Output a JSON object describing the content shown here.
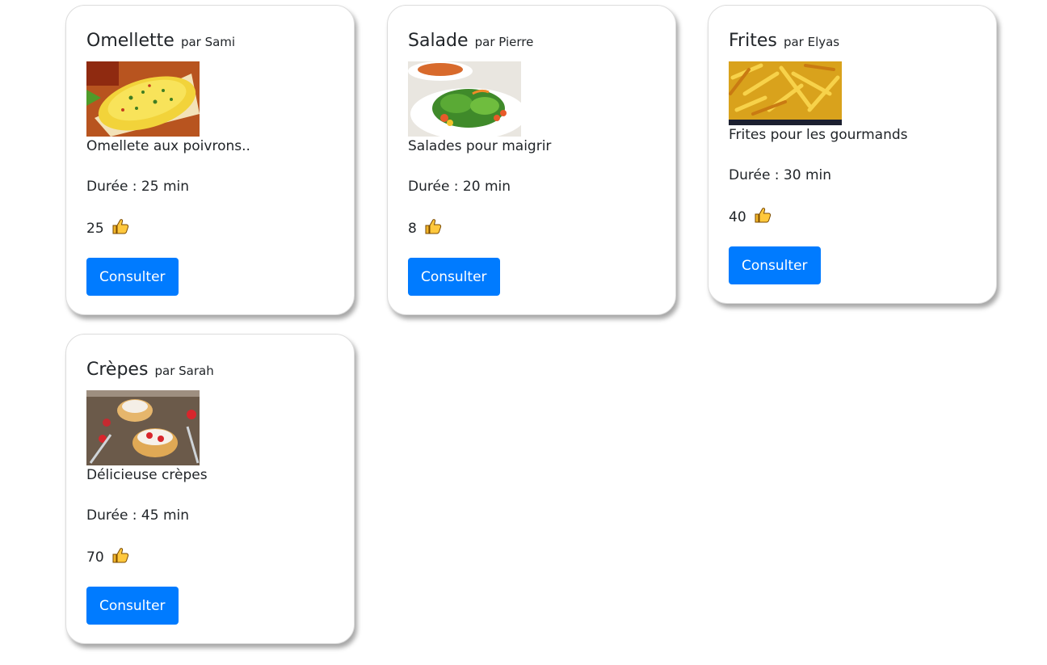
{
  "colors": {
    "button": "#007bff",
    "button_text": "#ffffff",
    "text": "#212529",
    "card_border": "#dcdcdc"
  },
  "recipes": [
    {
      "name": "Omellette",
      "author": "par Sami",
      "description": "Omellete aux poivrons..",
      "duration": "Durée : 25 min",
      "likes": "25",
      "button_label": "Consulter",
      "image": "omelette-photo"
    },
    {
      "name": "Salade",
      "author": "par Pierre",
      "description": "Salades pour maigrir",
      "duration": "Durée : 20 min",
      "likes": "8",
      "button_label": "Consulter",
      "image": "salad-photo"
    },
    {
      "name": "Frites",
      "author": "par Elyas",
      "description": "Frites pour les gourmands",
      "duration": "Durée : 30 min",
      "likes": "40",
      "button_label": "Consulter",
      "image": "fries-photo"
    },
    {
      "name": "Crèpes",
      "author": "par Sarah",
      "description": "Délicieuse crèpes",
      "duration": "Durée : 45 min",
      "likes": "70",
      "button_label": "Consulter",
      "image": "crepes-photo"
    }
  ]
}
